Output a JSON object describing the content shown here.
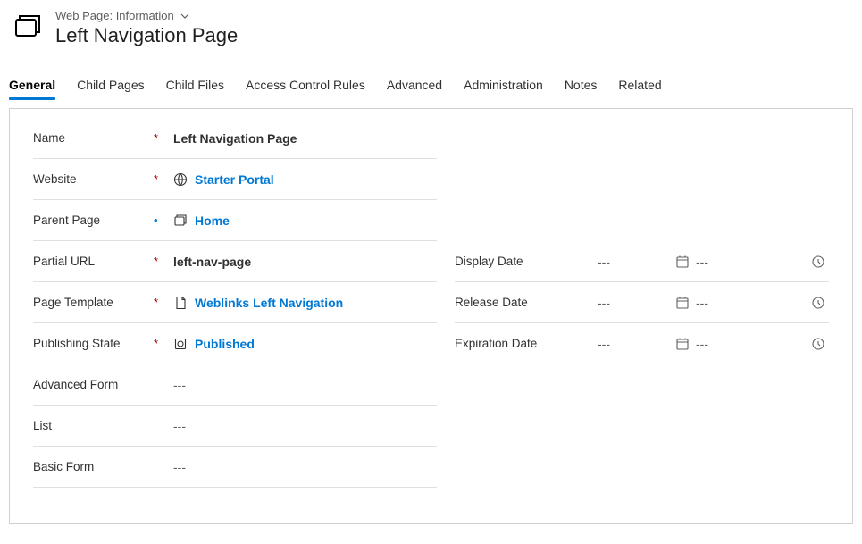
{
  "header": {
    "breadcrumb": "Web Page: Information",
    "title": "Left Navigation Page"
  },
  "tabs": {
    "items": [
      {
        "label": "General",
        "active": true
      },
      {
        "label": "Child Pages"
      },
      {
        "label": "Child Files"
      },
      {
        "label": "Access Control Rules"
      },
      {
        "label": "Advanced"
      },
      {
        "label": "Administration"
      },
      {
        "label": "Notes"
      },
      {
        "label": "Related"
      }
    ]
  },
  "fields": {
    "name": {
      "label": "Name",
      "required": true,
      "value": "Left Navigation Page"
    },
    "website": {
      "label": "Website",
      "required": true,
      "value": "Starter Portal"
    },
    "parent_page": {
      "label": "Parent Page",
      "required": "blue",
      "value": "Home"
    },
    "partial_url": {
      "label": "Partial URL",
      "required": true,
      "value": "left-nav-page"
    },
    "page_template": {
      "label": "Page Template",
      "required": true,
      "value": "Weblinks Left Navigation"
    },
    "publishing_state": {
      "label": "Publishing State",
      "required": true,
      "value": "Published"
    },
    "advanced_form": {
      "label": "Advanced Form",
      "value": "---"
    },
    "list": {
      "label": "List",
      "value": "---"
    },
    "basic_form": {
      "label": "Basic Form",
      "value": "---"
    },
    "display_date": {
      "label": "Display Date",
      "date": "---",
      "time": "---"
    },
    "release_date": {
      "label": "Release Date",
      "date": "---",
      "time": "---"
    },
    "expiration_date": {
      "label": "Expiration Date",
      "date": "---",
      "time": "---"
    }
  }
}
